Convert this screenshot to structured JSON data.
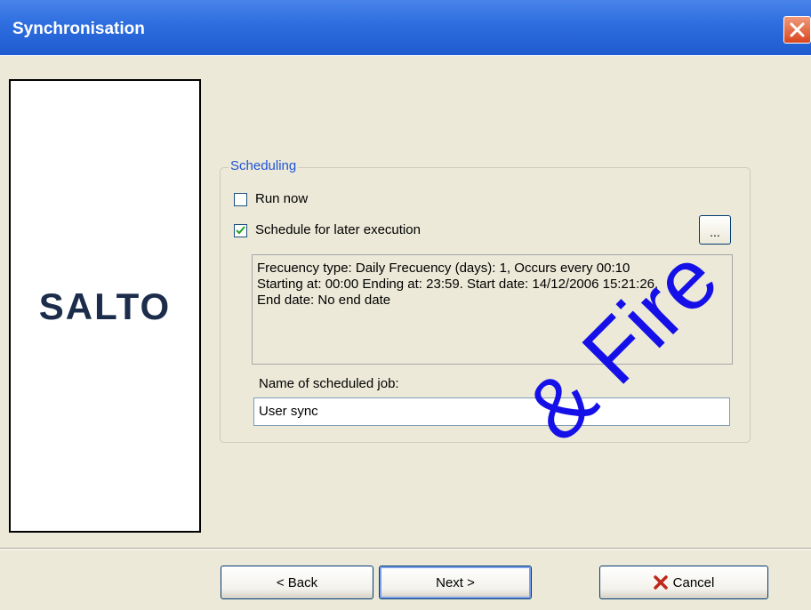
{
  "window": {
    "title": "Synchronisation"
  },
  "logo": {
    "text": "SALTO"
  },
  "scheduling": {
    "group_label": "Scheduling",
    "run_now_label": "Run now",
    "run_now_checked": false,
    "schedule_label": "Schedule for later execution",
    "schedule_checked": true,
    "browse_label": "...",
    "info_lines": [
      "Frecuency type: Daily Frecuency (days): 1, Occurs every 00:10",
      "Starting at: 00:00 Ending at: 23:59. Start date: 14/12/2006 15:21:26,",
      "End date: No end date"
    ],
    "job_name_label": "Name of scheduled job:",
    "job_name_value": "User sync"
  },
  "buttons": {
    "back": "< Back",
    "next": "Next >",
    "cancel": "Cancel"
  },
  "watermark": {
    "text": "& Fire"
  },
  "colors": {
    "titlebar": "#2f6fe0",
    "group_label": "#1f54d8",
    "watermark": "#1510e8"
  }
}
